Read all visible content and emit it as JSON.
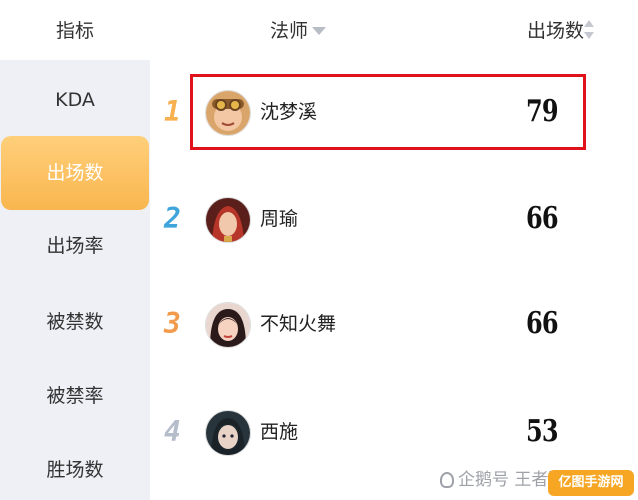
{
  "header": {
    "metric_col": "指标",
    "role_col": "法师",
    "count_col": "出场数"
  },
  "sidebar": {
    "items": [
      {
        "label": "KDA",
        "active": false
      },
      {
        "label": "出场数",
        "active": true
      },
      {
        "label": "出场率",
        "active": false
      },
      {
        "label": "被禁数",
        "active": false
      },
      {
        "label": "被禁率",
        "active": false
      },
      {
        "label": "胜场数",
        "active": false
      }
    ]
  },
  "rows": [
    {
      "rank": "1",
      "hero": "沈梦溪",
      "count": "79",
      "rank_color": "#f6b04f"
    },
    {
      "rank": "2",
      "hero": "周瑜",
      "count": "66",
      "rank_color": "#3fa4dc"
    },
    {
      "rank": "3",
      "hero": "不知火舞",
      "count": "66",
      "rank_color": "#f29b4c"
    },
    {
      "rank": "4",
      "hero": "西施",
      "count": "53",
      "rank_color": "#b5bdcb"
    }
  ],
  "watermark": {
    "text": "企鹅号 王者驿站",
    "logo": "亿图手游网"
  },
  "colors": {
    "active_tab": "#f9b64f",
    "highlight_border": "#e0121b",
    "sidebar_bg": "#eef0f5"
  }
}
